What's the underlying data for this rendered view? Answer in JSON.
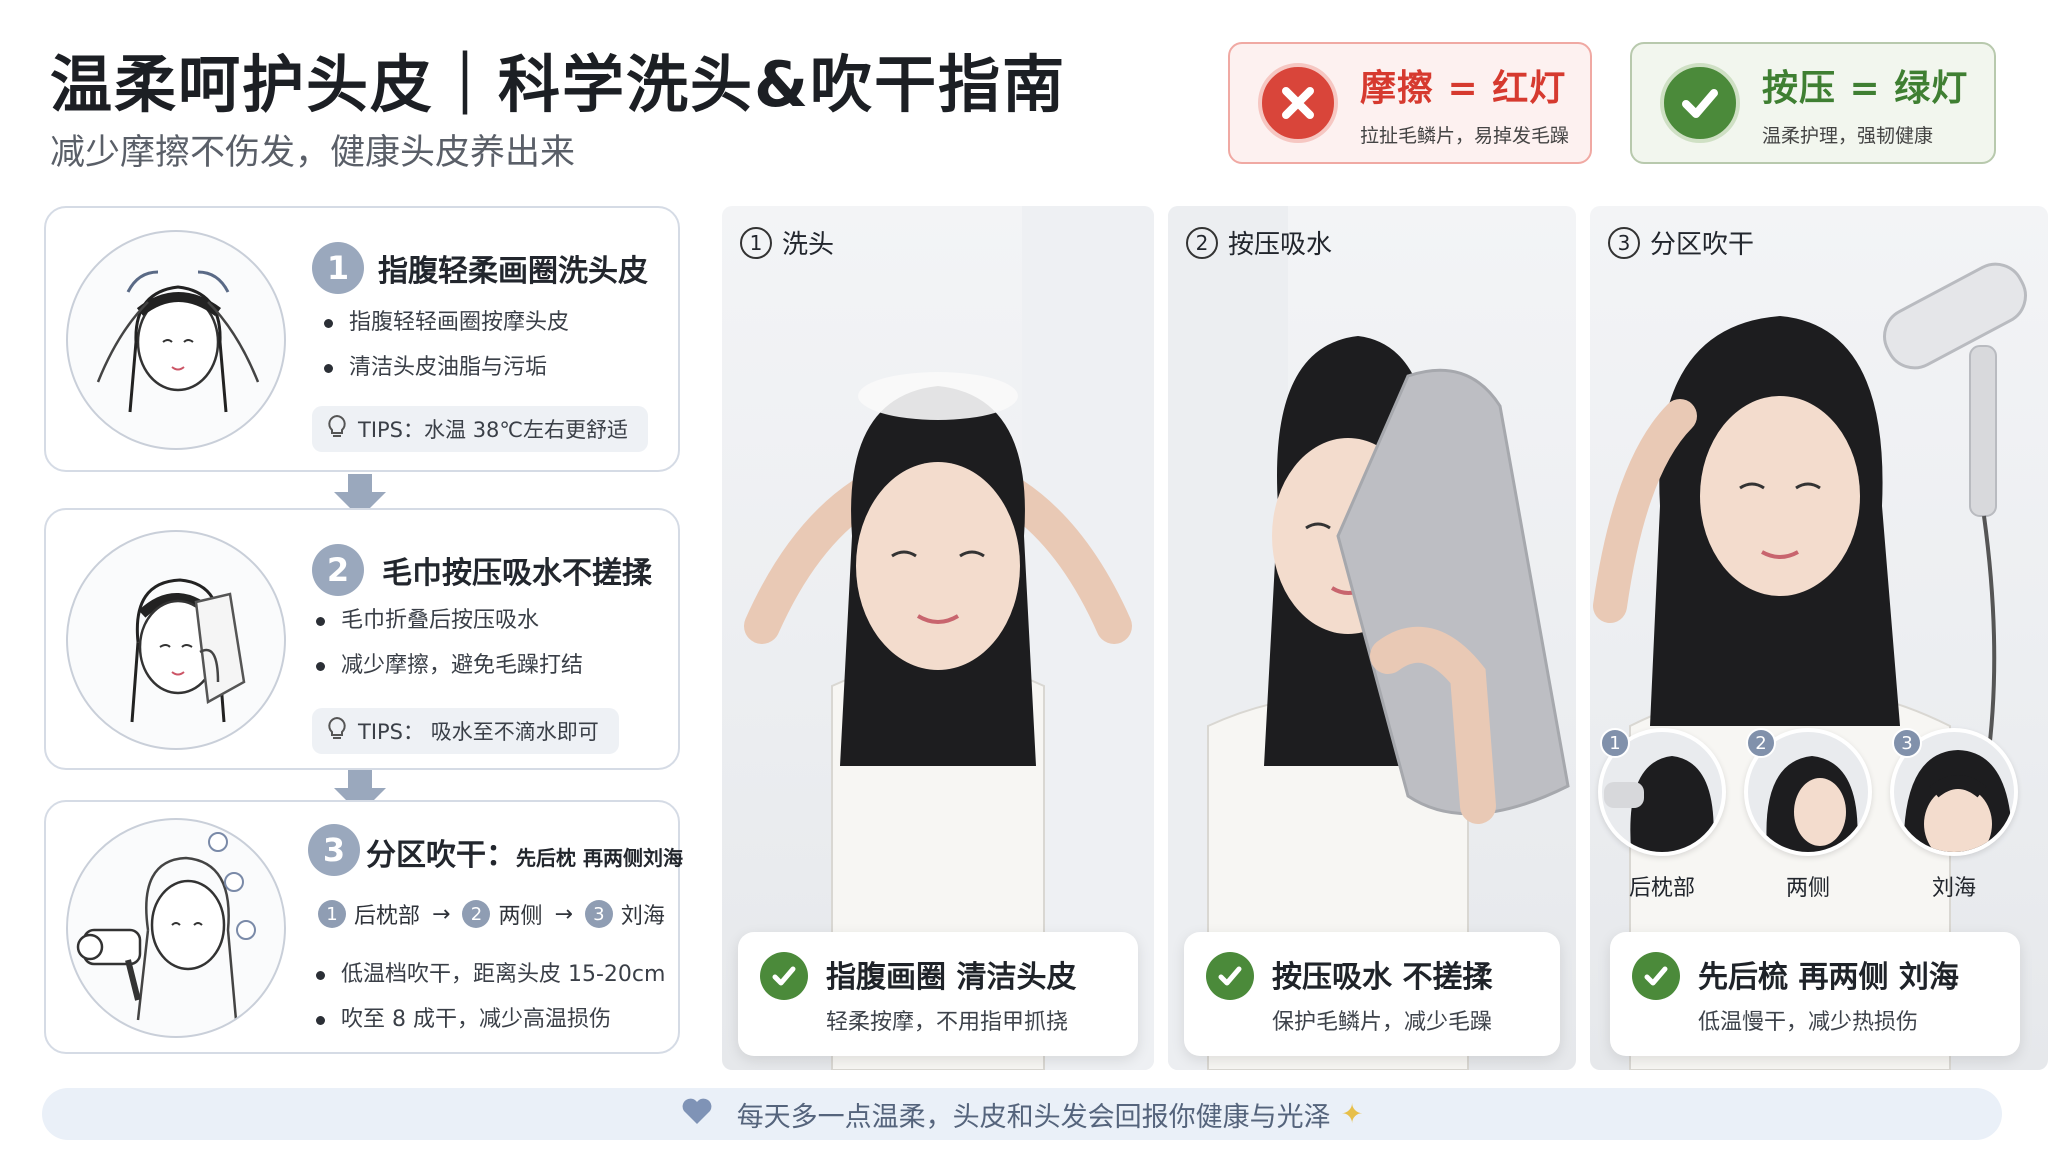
{
  "header": {
    "title": "温柔呵护头皮｜科学洗头&吹干指南",
    "subtitle": "减少摩擦不伤发，健康头皮养出来"
  },
  "legend": {
    "bad": {
      "title": "摩擦 = 红灯",
      "desc": "拉扯毛鳞片，易掉发毛躁",
      "color": "#d63a2f",
      "icon": "x-icon"
    },
    "good": {
      "title": "按压 = 绿灯",
      "desc": "温柔护理，强韧健康",
      "color": "#3f7f32",
      "icon": "check-icon"
    }
  },
  "steps": [
    {
      "num": "1",
      "title": "指腹轻柔画圈洗头皮",
      "bullets": [
        "指腹轻轻画圈按摩头皮",
        "清洁头皮油脂与污垢"
      ],
      "tips": "TIPS：水温 38℃左右更舒适"
    },
    {
      "num": "2",
      "title": "毛巾按压吸水不搓揉",
      "bullets": [
        "毛巾折叠后按压吸水",
        "减少摩擦，避免毛躁打结"
      ],
      "tips": "TIPS：  吸水至不滴水即可"
    },
    {
      "num": "3",
      "title": "分区吹干：",
      "title_note": "先后枕 再两侧刘海",
      "sequence": [
        {
          "n": "1",
          "label": "后枕部"
        },
        {
          "n": "2",
          "label": "两侧"
        },
        {
          "n": "3",
          "label": "刘海"
        }
      ],
      "bullets": [
        "低温档吹干，距离头皮 15-20cm",
        "吹至 8 成干，减少高温损伤"
      ]
    }
  ],
  "panels": [
    {
      "num": "1",
      "label": "洗头",
      "caption_title": "指腹画圈   清洁头皮",
      "caption_sub": "轻柔按摩，不用指甲抓挠"
    },
    {
      "num": "2",
      "label": "按压吸水",
      "caption_title": "按压吸水   不搓揉",
      "caption_sub": "保护毛鳞片，减少毛躁"
    },
    {
      "num": "3",
      "label": "分区吹干",
      "caption_title": "先后梳  再两侧  刘海",
      "caption_sub": "低温慢干，减少热损伤",
      "zones": [
        {
          "n": "1",
          "label": "后枕部"
        },
        {
          "n": "2",
          "label": "两侧"
        },
        {
          "n": "3",
          "label": "刘海"
        }
      ]
    }
  ],
  "footer": {
    "text": "每天多一点温柔，头皮和头发会回报你健康与光泽",
    "icon": "heart-icon"
  }
}
